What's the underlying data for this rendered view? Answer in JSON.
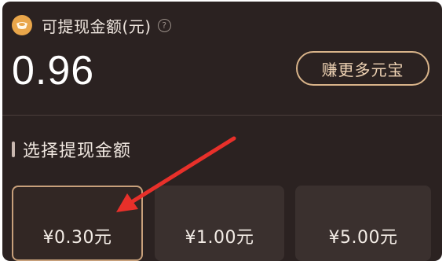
{
  "header": {
    "coin_icon": "gold-coin-icon",
    "balance_label": "可提现金额(元)",
    "help_icon": "question-circle-icon",
    "help_glyph": "?"
  },
  "balance": {
    "value": "0.96"
  },
  "earn_button": {
    "label": "赚更多元宝"
  },
  "section": {
    "title": "选择提现金额"
  },
  "amounts": [
    {
      "label": "¥0.30元",
      "selected": true
    },
    {
      "label": "¥1.00元",
      "selected": false
    },
    {
      "label": "¥5.00元",
      "selected": false
    }
  ],
  "annotation": {
    "arrow_color": "#e8302a"
  },
  "colors": {
    "panel_bg": "#2b2221",
    "accent_gold": "#d9b48a",
    "coin": "#e9a64a"
  }
}
